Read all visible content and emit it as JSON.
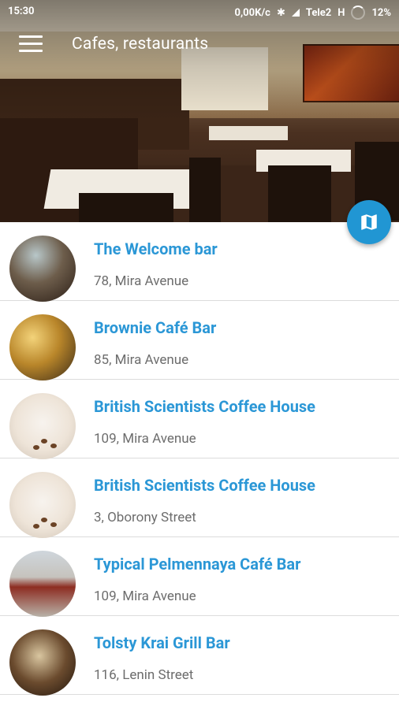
{
  "status_bar": {
    "time": "15:30",
    "speed": "0,00K/c",
    "carrier": "Tele2",
    "network": "H",
    "battery": "12%"
  },
  "toolbar": {
    "menu_icon": "hamburger-icon",
    "title": "Cafes,  restaurants"
  },
  "fab": {
    "icon": "map-icon",
    "color": "#2196d3"
  },
  "accent_color": "#2b97d6",
  "places": [
    {
      "name": "The Welcome bar",
      "address": "78, Mira Avenue"
    },
    {
      "name": "Brownie Café Bar",
      "address": "85, Mira Avenue"
    },
    {
      "name": "British Scientists Coffee House",
      "address": "109, Mira Avenue"
    },
    {
      "name": "British Scientists Coffee House",
      "address": "3, Oborony Street"
    },
    {
      "name": "Typical Pelmennaya Café Bar",
      "address": "109, Mira Avenue"
    },
    {
      "name": "Tolsty Krai Grill Bar",
      "address": "116, Lenin Street"
    }
  ]
}
